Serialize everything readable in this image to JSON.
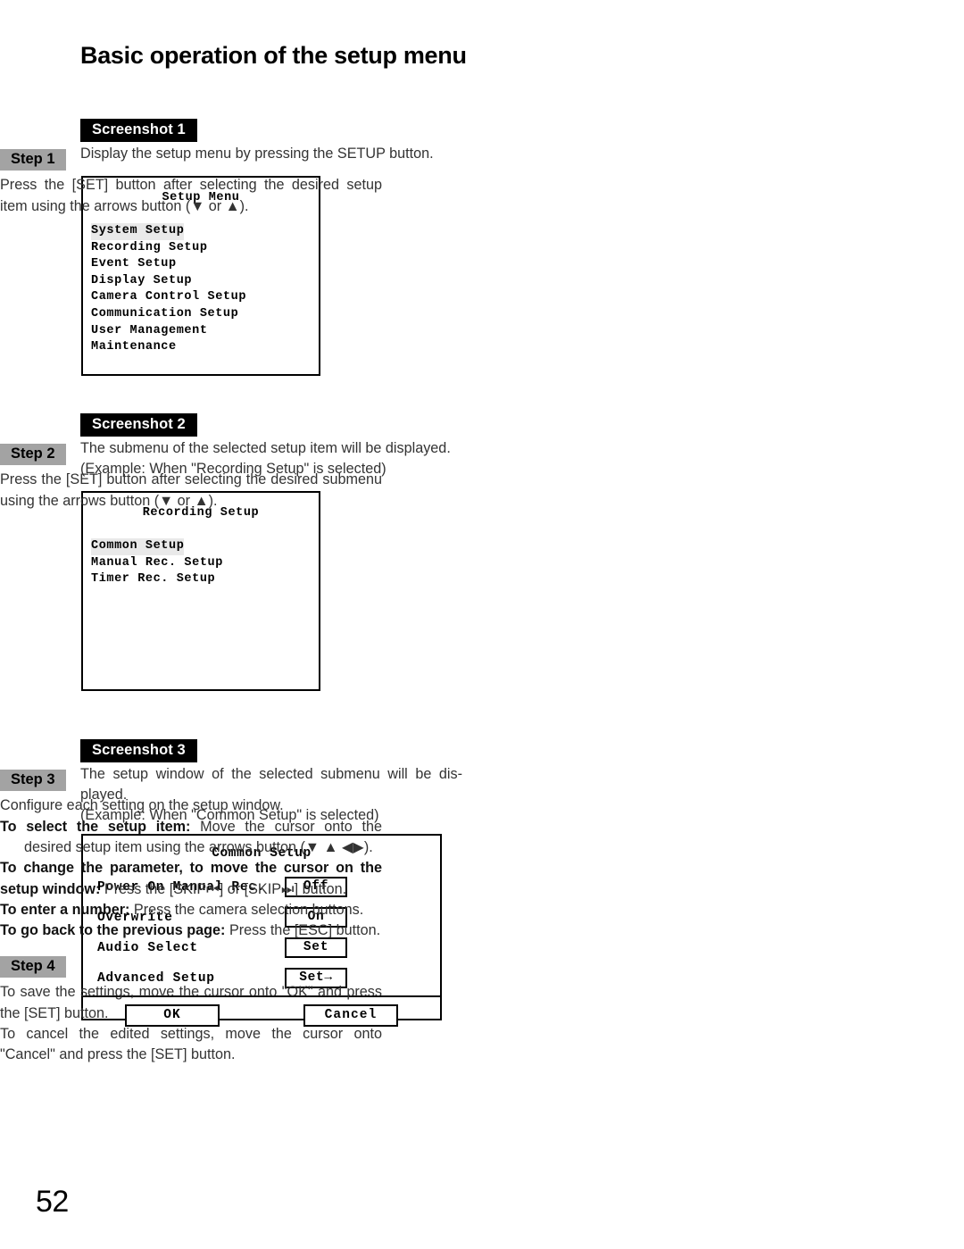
{
  "page": {
    "title": "Basic operation of the setup menu",
    "number": "52"
  },
  "screenshot1": {
    "badge": "Screenshot 1",
    "description": "Display the setup menu by pressing the SETUP button.",
    "osd": {
      "title": "Setup Menu",
      "items": [
        "System Setup",
        "Recording Setup",
        "Event Setup",
        "Display Setup",
        "Camera Control Setup",
        "Communication Setup",
        "User Management",
        "Maintenance"
      ],
      "selected_index": 0
    }
  },
  "screenshot2": {
    "badge": "Screenshot 2",
    "description_line1": "The submenu of the selected setup item will be displayed.",
    "description_line2": "(Example: When \"Recording Setup\" is selected)",
    "osd": {
      "title": "Recording Setup",
      "items": [
        "Common Setup",
        "Manual Rec. Setup",
        "Timer Rec. Setup"
      ],
      "selected_index": 0
    }
  },
  "screenshot3": {
    "badge": "Screenshot 3",
    "description_line1": "The setup window of the selected submenu will be dis-",
    "description_line2": "played.",
    "description_line3": "(Example: When \"Common Setup\" is selected)",
    "osd": {
      "title": "Common Setup",
      "rows": [
        {
          "label": "Power On Manual Rec.",
          "value": "Off"
        },
        {
          "label": "Overwrite",
          "value": "On"
        },
        {
          "label": "Audio Select",
          "value": "Set"
        },
        {
          "label": "Advanced Setup",
          "value": "Set→"
        }
      ],
      "buttons": [
        {
          "label": "OK"
        },
        {
          "label": "Cancel"
        }
      ]
    }
  },
  "steps": [
    {
      "badge": "Step 1",
      "line1": "Press the [SET] button after selecting the desired setup",
      "line2": "item using the arrows button (▼ or ▲)."
    },
    {
      "badge": "Step 2",
      "line1": "Press the [SET] button after selecting the desired submenu",
      "line2": "using the arrows button (▼ or ▲)."
    },
    {
      "badge": "Step 3",
      "line1": "Configure each setting on the setup window.",
      "line2_bold": "To select the setup item:",
      "line2_rest": "Move the cursor onto the",
      "line3": "desired setup item using the arrows button (▼ ▲ ◀▶).",
      "line4_bold": "To change the parameter, to move the cursor on the",
      "line5_bold": "setup window:",
      "line5_rest_a": "Press the [SKIP",
      "line5_skip_back": "⏮",
      "line5_rest_b": "] or [SKIP",
      "line5_skip_fwd": "⏭",
      "line5_rest_c": "] button.",
      "line6_bold": "To enter a number:",
      "line6_rest": "Press the camera selection buttons.",
      "line7_bold": "To go back to the previous page:",
      "line7_rest": "Press the [ESC] button."
    },
    {
      "badge": "Step 4",
      "line1": "To save the settings, move the cursor onto \"OK\" and press",
      "line2": "the [SET] button.",
      "line3": "To cancel the edited settings, move the cursor onto",
      "line4": "\"Cancel\" and press the [SET] button."
    }
  ]
}
